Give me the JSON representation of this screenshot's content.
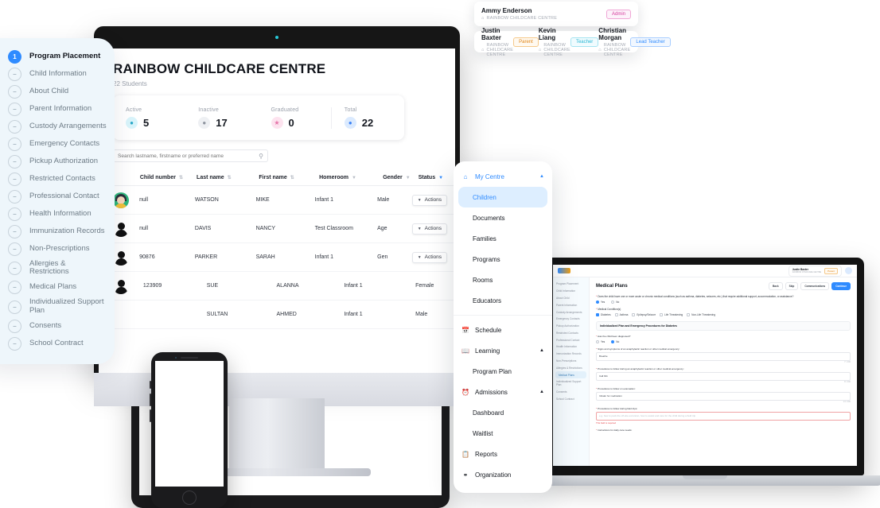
{
  "steps": {
    "items": [
      {
        "label": "Program Placement",
        "state": "current",
        "marker": "1"
      },
      {
        "label": "Child Information",
        "state": "todo",
        "marker": "–"
      },
      {
        "label": "About Child",
        "state": "todo",
        "marker": "–"
      },
      {
        "label": "Parent Information",
        "state": "todo",
        "marker": "–"
      },
      {
        "label": "Custody Arrangements",
        "state": "todo",
        "marker": "–"
      },
      {
        "label": "Emergency Contacts",
        "state": "todo",
        "marker": "–"
      },
      {
        "label": "Pickup Authorization",
        "state": "todo",
        "marker": "–"
      },
      {
        "label": "Restricted Contacts",
        "state": "todo",
        "marker": "–"
      },
      {
        "label": "Professional Contact",
        "state": "todo",
        "marker": "–"
      },
      {
        "label": "Health Information",
        "state": "todo",
        "marker": "–"
      },
      {
        "label": "Immunization Records",
        "state": "todo",
        "marker": "–"
      },
      {
        "label": "Non-Prescriptions",
        "state": "todo",
        "marker": "–"
      },
      {
        "label": "Allergies & Restrictions",
        "state": "todo",
        "marker": "–"
      },
      {
        "label": "Medical Plans",
        "state": "todo",
        "marker": "–"
      },
      {
        "label": "Individualized Support Plan",
        "state": "todo",
        "marker": "–"
      },
      {
        "label": "Consents",
        "state": "todo",
        "marker": "–"
      },
      {
        "label": "School Contract",
        "state": "todo",
        "marker": "–"
      }
    ]
  },
  "desktop": {
    "title": "RAINBOW CHILDCARE CENTRE",
    "subtitle": "22 Students",
    "stats": [
      {
        "label": "Active",
        "value": "5",
        "icon": "person-icon",
        "color": "#2aa9c9"
      },
      {
        "label": "Inactive",
        "value": "17",
        "icon": "person-icon",
        "color": "#8e949f"
      },
      {
        "label": "Graduated",
        "value": "0",
        "icon": "graduation-cap-icon",
        "color": "#e573a8"
      },
      {
        "label": "Total",
        "value": "22",
        "icon": "people-icon",
        "color": "#3b82f6"
      }
    ],
    "search": {
      "placeholder": "Search lastname, firstname or preferred name",
      "value": ""
    },
    "table": {
      "columns": [
        {
          "label": "Child number",
          "control": "sort"
        },
        {
          "label": "Last name",
          "control": "sort"
        },
        {
          "label": "First name",
          "control": "sort"
        },
        {
          "label": "Homeroom",
          "control": "filter"
        },
        {
          "label": "Gender",
          "control": "filter"
        },
        {
          "label": "Status",
          "control": "filter-active"
        }
      ],
      "action_label": "Actions",
      "rows": [
        {
          "avatar": "face",
          "child_number": "null",
          "last_name": "WATSON",
          "first_name": "MIKE",
          "homeroom": "Infant 1",
          "gender": "Male",
          "status": ""
        },
        {
          "avatar": "silhouette",
          "child_number": "null",
          "last_name": "DAVIS",
          "first_name": "NANCY",
          "homeroom": "Test Classroom",
          "gender": "Age",
          "status": ""
        },
        {
          "avatar": "silhouette",
          "child_number": "90876",
          "last_name": "PARKER",
          "first_name": "SARAH",
          "homeroom": "Infant 1",
          "gender": "Gen",
          "status": ""
        },
        {
          "avatar": "silhouette",
          "child_number": "123909",
          "last_name": "SUE",
          "first_name": "ALANNA",
          "homeroom": "Infant 1",
          "gender": "Female",
          "status": ""
        },
        {
          "avatar": "silhouette",
          "child_number": "",
          "last_name": "SULTAN",
          "first_name": "AHMED",
          "homeroom": "Infant 1",
          "gender": "Male",
          "status": ""
        }
      ]
    }
  },
  "nav": {
    "items": [
      {
        "label": "My Centre",
        "icon": "home-icon",
        "type": "group",
        "expanded": true,
        "accent": "#2f8bff"
      },
      {
        "label": "Children",
        "type": "sub",
        "active": true
      },
      {
        "label": "Documents",
        "type": "sub",
        "active": false
      },
      {
        "label": "Families",
        "type": "sub",
        "active": false
      },
      {
        "label": "Programs",
        "type": "sub",
        "active": false
      },
      {
        "label": "Rooms",
        "type": "sub",
        "active": false
      },
      {
        "label": "Educators",
        "type": "sub",
        "active": false
      },
      {
        "label": "Schedule",
        "icon": "calendar-icon",
        "type": "item"
      },
      {
        "label": "Learning",
        "icon": "book-icon",
        "type": "group",
        "expanded": true
      },
      {
        "label": "Program Plan",
        "type": "sub",
        "active": false
      },
      {
        "label": "Admissions",
        "icon": "clock-icon",
        "type": "group",
        "expanded": true
      },
      {
        "label": "Dashboard",
        "type": "sub",
        "active": false
      },
      {
        "label": "Waitlist",
        "type": "sub",
        "active": false
      },
      {
        "label": "Reports",
        "icon": "report-icon",
        "type": "item"
      },
      {
        "label": "Organization",
        "icon": "org-icon",
        "type": "item"
      }
    ]
  },
  "users": {
    "highlighted": {
      "name": "Ammy Enderson",
      "org": "RAINBOW CHILDCARE CENTRE",
      "role": "Admin",
      "role_color": "#d6409f"
    },
    "list": [
      {
        "name": "Justin Baxter",
        "org": "RAINBOW CHILDCARE CENTRE",
        "role": "Parent",
        "role_color": "#e08617"
      },
      {
        "name": "Kevin Liang",
        "org": "RAINBOW CHILDCARE CENTRE",
        "role": "Teacher",
        "role_color": "#27b7d4"
      },
      {
        "name": "Christian Morgan",
        "org": "RAINBOW CHILDCARE CENTRE",
        "role": "Lead Teacher",
        "role_color": "#2f8bff"
      }
    ]
  },
  "laptop": {
    "user": {
      "name": "Justin Baxter",
      "org": "RAINBOW CHILDCARE CENTRE",
      "role": "Parent"
    },
    "page_title": "Medical Plans",
    "buttons": [
      {
        "label": "Back",
        "style": "default"
      },
      {
        "label": "Skip",
        "style": "default"
      },
      {
        "label": "Communications",
        "style": "default"
      },
      {
        "label": "Continue",
        "style": "primary"
      }
    ],
    "sidebar": [
      "Program Placement",
      "Child Information",
      "About Child",
      "Parent Information",
      "Custody Arrangements",
      "Emergency Contacts",
      "Pickup Authorization",
      "Restricted Contacts",
      "Professional Contact",
      "Health Information",
      "Immunization Records",
      "Non-Prescriptions",
      "Allergies & Restrictions",
      "Medical Plans",
      "Individualized Support Plan",
      "Consents",
      "School Contract"
    ],
    "question": "Does the child have one or more acute or chronic medical conditions (such as asthma, diabetes, seizures, etc.) that require additional support, accommodation, or assistance?",
    "yesno": [
      {
        "label": "Yes",
        "selected": true
      },
      {
        "label": "No",
        "selected": false
      }
    ],
    "conditions_label": "Medical Condition(s)",
    "conditions": [
      {
        "label": "Diabetes",
        "checked": true
      },
      {
        "label": "Asthma",
        "checked": false
      },
      {
        "label": "Epilepsy/Seizure",
        "checked": false
      },
      {
        "label": "Life Threatening",
        "checked": false
      },
      {
        "label": "Non-Life Threatening",
        "checked": false
      }
    ],
    "accordion_title": "Individualized Plan and Emergency Procedures for Diabetes",
    "diagnosed_label": "Has the child been diagnosed?",
    "diagnosed": [
      {
        "label": "Yes",
        "selected": false
      },
      {
        "label": "No",
        "selected": true
      }
    ],
    "fields": [
      {
        "label": "Signs and symptoms of an anaphylactic reaction or other medical emergency:",
        "value": "Breathe",
        "count": "7 / 400",
        "error": ""
      },
      {
        "label": "Procedures to follow during an anaphylactic reaction or other medical emergency:",
        "value": "Call 911",
        "count": "8 / 400",
        "error": ""
      },
      {
        "label": "Procedures to follow on evacuation:",
        "value": "Inhaler for medication",
        "count": "14 / 400",
        "error": ""
      },
      {
        "label": "Procedures to follow during field trips:",
        "value": "",
        "placeholder": "e.g. how to pack the off-site excursion, how to assist and care for the child during a field trip",
        "count": "0 / 400",
        "error": "This field is required"
      },
      {
        "label": "Instructions for daily care needs:",
        "value": "",
        "count": "",
        "error": ""
      }
    ]
  }
}
